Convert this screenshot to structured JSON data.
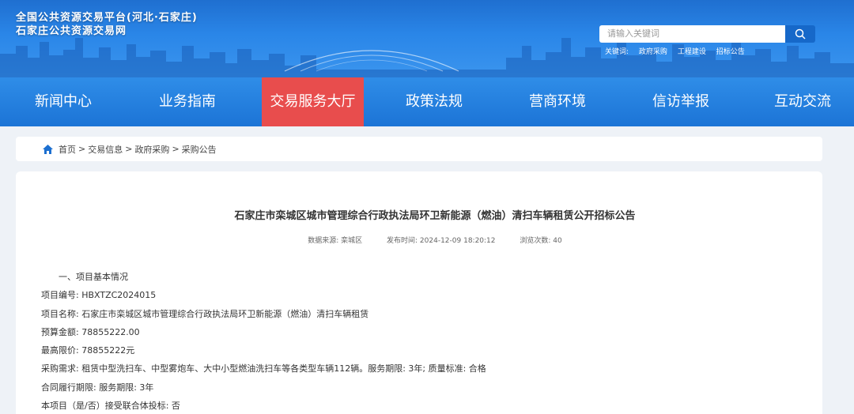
{
  "header": {
    "site_title_line1": "全国公共资源交易平台(河北·石家庄)",
    "site_title_line2": "石家庄公共资源交易网",
    "search_placeholder": "请输入关键词",
    "keywords_label": "关键词:",
    "keywords": [
      "政府采购",
      "工程建设",
      "招标公告"
    ]
  },
  "nav": {
    "items": [
      "新闻中心",
      "业务指南",
      "交易服务大厅",
      "政策法规",
      "营商环境",
      "信访举报",
      "互动交流"
    ],
    "active_index": 2,
    "active_color": "#e84d4d"
  },
  "breadcrumb": {
    "items": [
      "首页",
      "交易信息",
      "政府采购",
      "采购公告"
    ],
    "separator": ">"
  },
  "article": {
    "title": "石家庄市栾城区城市管理综合行政执法局环卫新能源（燃油）清扫车辆租赁公开招标公告",
    "meta_source": "数据来源:  栾城区",
    "meta_time": "发布时间:  2024-12-09 18:20:12",
    "meta_views": "浏览次数:  40",
    "lines": [
      "一、项目基本情况",
      "项目编号:  HBXTZC2024015",
      "项目名称:  石家庄市栾城区城市管理综合行政执法局环卫新能源（燃油）清扫车辆租赁",
      "预算金额:  78855222.00",
      "最高限价:  78855222元",
      "采购需求:  租赁中型洗扫车、中型雾炮车、大中小型燃油洗扫车等各类型车辆112辆。服务期限: 3年;  质量标准: 合格",
      "合同履行期限:  服务期限: 3年",
      "本项目（是/否）接受联合体投标:  否"
    ]
  },
  "colors": {
    "header_blue": "#2a86e8",
    "nav_blue": "#1c74d6",
    "active_red": "#e84d4d",
    "page_bg": "#eef2f7"
  }
}
